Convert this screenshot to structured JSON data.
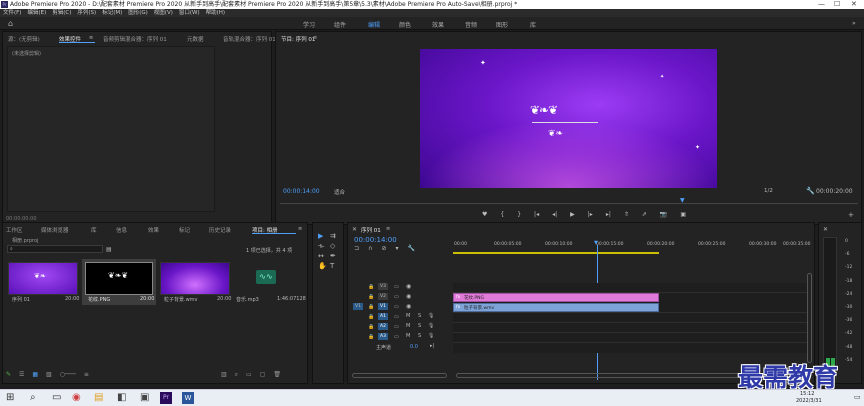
{
  "window": {
    "title": "Adobe Premiere Pro 2020 - D:\\配套素材 Premiere Pro 2020 从新手到高手\\配套素材 Premiere Pro 2020 从新手到高手\\第5章\\5.3\\素材\\Adobe Premiere Pro Auto-Save\\相册.prproj *"
  },
  "menu": [
    "文件(F)",
    "编辑(E)",
    "剪辑(C)",
    "序列(S)",
    "标记(M)",
    "图形(G)",
    "视图(V)",
    "窗口(W)",
    "帮助(H)"
  ],
  "workspaces": [
    "学习",
    "组件",
    "编辑",
    "颜色",
    "效果",
    "音频",
    "图形",
    "库"
  ],
  "source_panel": {
    "tabs": [
      "源：(无剪辑)",
      "效果控件",
      "音频剪辑混合器：序列 01",
      "元数据",
      "音轨混合器：序列 01"
    ],
    "empty": "(未选择剪辑)",
    "timecode": "00:00:00:00"
  },
  "program": {
    "title": "节目: 序列 01",
    "timecode": "00:00:14:00",
    "fit": "适合",
    "ratio": "1/2",
    "duration": "00:00:20:00"
  },
  "project": {
    "tabs": [
      "工作区",
      "媒体浏览器",
      "库",
      "信息",
      "效果",
      "标记",
      "历史记录",
      "项目: 相册"
    ],
    "file": "相册.prproj",
    "selection": "1 项已选择，共 4 项",
    "items": [
      {
        "name": "序列 01",
        "dur": "20:00"
      },
      {
        "name": "花纹.PNG",
        "dur": "20:00"
      },
      {
        "name": "粒子背景.wmv",
        "dur": "20:00"
      },
      {
        "name": "音乐.mp3",
        "dur": "1:46:07128"
      }
    ]
  },
  "timeline": {
    "tab": "序列 01",
    "timecode": "00:00:14:00",
    "ruler": [
      "00:00",
      "00:00:05:00",
      "00:00:10:00",
      "00:00:15:00",
      "00:00:20:00",
      "00:00:25:00",
      "00:00:30:00",
      "00:00:35:00"
    ],
    "tracks": [
      "V3",
      "V2",
      "V1",
      "A1",
      "A2",
      "A3",
      "主声道"
    ],
    "master_val": "0.0",
    "clips": [
      {
        "name": "花纹.PNG"
      },
      {
        "name": "粒子背景.wmv"
      }
    ]
  },
  "meter": [
    "0",
    "-6",
    "-12",
    "-18",
    "-24",
    "-30",
    "-36",
    "-42",
    "-48",
    "-54"
  ],
  "taskbar": {
    "time": "15:12",
    "date": "2022/3/31"
  },
  "watermark": "最需教育",
  "colors": {
    "accent": "#4f9ef8",
    "clip_pink": "#e07ad8",
    "clip_blue": "#7da3d8"
  }
}
